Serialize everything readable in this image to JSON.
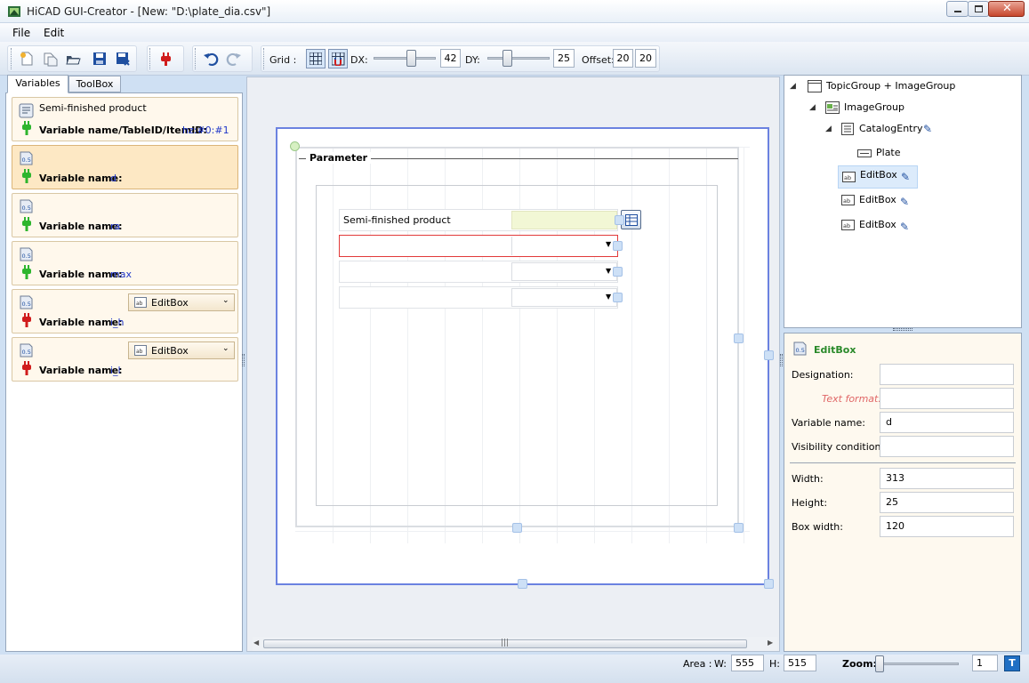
{
  "window": {
    "title": "HiCAD GUI-Creator - [New: \"D:\\plate_dia.csv\"]"
  },
  "menu": {
    "items": [
      "File",
      "Edit"
    ]
  },
  "toolbar": {
    "grid_label": "Grid  :",
    "dx_label": "DX:",
    "dx_value": "42",
    "dy_label": "DY:",
    "dy_value": "25",
    "offset_label": "Offset:",
    "offset_x": "20",
    "offset_y": "20"
  },
  "left_tabs": [
    "Variables",
    "ToolBox"
  ],
  "variables": [
    {
      "title": "Semi-finished product",
      "label": "Variable name/TableID/ItemID:",
      "value": "hz:#0:#1",
      "plug_color": "#2db52d",
      "control": ""
    },
    {
      "title": "",
      "label": "Variable name:",
      "value": "d",
      "plug_color": "#2db52d",
      "control": ""
    },
    {
      "title": "",
      "label": "Variable name:",
      "value": "ra",
      "plug_color": "#2db52d",
      "control": ""
    },
    {
      "title": "",
      "label": "Variable name:",
      "value": "max",
      "plug_color": "#2db52d",
      "control": ""
    },
    {
      "title": "",
      "label": "Variable name:",
      "value": "i_h",
      "plug_color": "#d01c1c",
      "control": "EditBox"
    },
    {
      "title": "",
      "label": "Variable name:",
      "value": "i_l",
      "plug_color": "#d01c1c",
      "control": "EditBox"
    }
  ],
  "design": {
    "group_title": "Parameter",
    "row1_label": "Semi-finished product"
  },
  "tree": {
    "nodes": [
      {
        "label": "TopicGroup + ImageGroup",
        "icon": "topic-group-icon"
      },
      {
        "label": "ImageGroup",
        "icon": "image-group-icon"
      },
      {
        "label": "CatalogEntry",
        "icon": "catalog-entry-icon"
      },
      {
        "label": "Plate",
        "icon": "plate-icon"
      },
      {
        "label": "EditBox",
        "icon": "editbox-icon"
      },
      {
        "label": "EditBox",
        "icon": "editbox-icon"
      },
      {
        "label": "EditBox",
        "icon": "editbox-icon"
      }
    ]
  },
  "properties": {
    "header": "EditBox",
    "designation_label": "Designation:",
    "designation_value": "",
    "text_format_label": "Text format:",
    "text_format_value": "",
    "variable_name_label": "Variable name:",
    "variable_name_value": "d",
    "visibility_label": "Visibility condition:",
    "visibility_value": "",
    "width_label": "Width:",
    "width_value": "313",
    "height_label": "Height:",
    "height_value": "25",
    "box_width_label": "Box width:",
    "box_width_value": "120"
  },
  "status": {
    "area_label": "Area :",
    "w_label": "W:",
    "w_value": "555",
    "h_label": "H:",
    "h_value": "515",
    "zoom_label": "Zoom:",
    "zoom_value": "1"
  }
}
